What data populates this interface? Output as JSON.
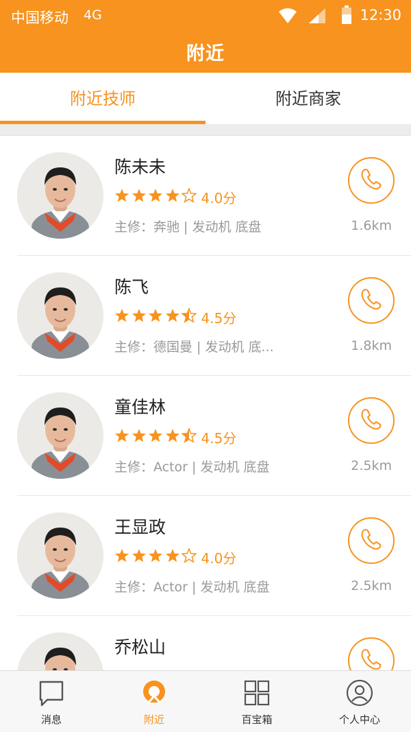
{
  "status_bar": {
    "carrier": "中国移动",
    "network": "4G",
    "time": "12:30"
  },
  "header": {
    "title": "附近"
  },
  "tabs": [
    {
      "label": "附近技师",
      "active": true
    },
    {
      "label": "附近商家",
      "active": false
    }
  ],
  "technicians": [
    {
      "name": "陈未未",
      "rating": 4.0,
      "rating_text": "4.0分",
      "specialty": "主修：奔驰 | 发动机 底盘",
      "distance": "1.6km"
    },
    {
      "name": "陈飞",
      "rating": 4.5,
      "rating_text": "4.5分",
      "specialty": "主修：德国曼 | 发动机 底...",
      "distance": "1.8km"
    },
    {
      "name": "童佳林",
      "rating": 4.5,
      "rating_text": "4.5分",
      "specialty": "主修：Actor | 发动机 底盘",
      "distance": "2.5km"
    },
    {
      "name": "王显政",
      "rating": 4.0,
      "rating_text": "4.0分",
      "specialty": "主修：Actor | 发动机 底盘",
      "distance": "2.5km"
    },
    {
      "name": "乔松山",
      "rating": null,
      "rating_text": "",
      "specialty": "",
      "distance": ""
    }
  ],
  "bottom_nav": [
    {
      "label": "消息",
      "icon": "message-icon",
      "active": false
    },
    {
      "label": "附近",
      "icon": "location-icon",
      "active": true
    },
    {
      "label": "百宝箱",
      "icon": "grid-icon",
      "active": false
    },
    {
      "label": "个人中心",
      "icon": "user-icon",
      "active": false
    }
  ],
  "colors": {
    "accent": "#f7931e",
    "text": "#222222",
    "muted": "#999999"
  }
}
